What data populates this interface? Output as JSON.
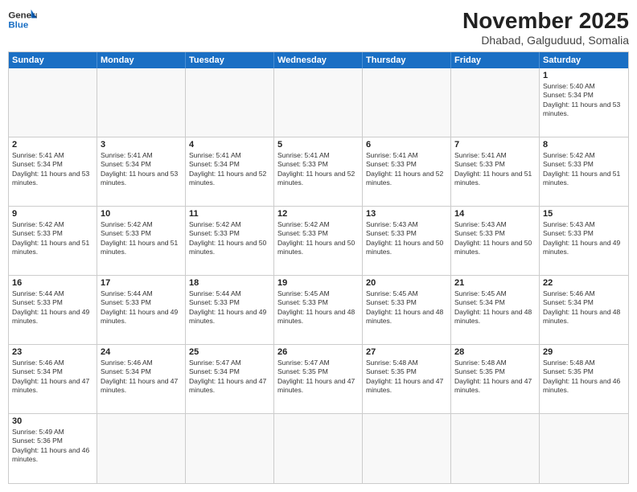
{
  "header": {
    "logo_line1": "General",
    "logo_line2": "Blue",
    "month_title": "November 2025",
    "location": "Dhabad, Galguduud, Somalia"
  },
  "days_of_week": [
    "Sunday",
    "Monday",
    "Tuesday",
    "Wednesday",
    "Thursday",
    "Friday",
    "Saturday"
  ],
  "weeks": [
    [
      {
        "day": "",
        "sunrise": "",
        "sunset": "",
        "daylight": ""
      },
      {
        "day": "",
        "sunrise": "",
        "sunset": "",
        "daylight": ""
      },
      {
        "day": "",
        "sunrise": "",
        "sunset": "",
        "daylight": ""
      },
      {
        "day": "",
        "sunrise": "",
        "sunset": "",
        "daylight": ""
      },
      {
        "day": "",
        "sunrise": "",
        "sunset": "",
        "daylight": ""
      },
      {
        "day": "",
        "sunrise": "",
        "sunset": "",
        "daylight": ""
      },
      {
        "day": "1",
        "sunrise": "Sunrise: 5:40 AM",
        "sunset": "Sunset: 5:34 PM",
        "daylight": "Daylight: 11 hours and 53 minutes."
      }
    ],
    [
      {
        "day": "2",
        "sunrise": "Sunrise: 5:41 AM",
        "sunset": "Sunset: 5:34 PM",
        "daylight": "Daylight: 11 hours and 53 minutes."
      },
      {
        "day": "3",
        "sunrise": "Sunrise: 5:41 AM",
        "sunset": "Sunset: 5:34 PM",
        "daylight": "Daylight: 11 hours and 53 minutes."
      },
      {
        "day": "4",
        "sunrise": "Sunrise: 5:41 AM",
        "sunset": "Sunset: 5:34 PM",
        "daylight": "Daylight: 11 hours and 52 minutes."
      },
      {
        "day": "5",
        "sunrise": "Sunrise: 5:41 AM",
        "sunset": "Sunset: 5:33 PM",
        "daylight": "Daylight: 11 hours and 52 minutes."
      },
      {
        "day": "6",
        "sunrise": "Sunrise: 5:41 AM",
        "sunset": "Sunset: 5:33 PM",
        "daylight": "Daylight: 11 hours and 52 minutes."
      },
      {
        "day": "7",
        "sunrise": "Sunrise: 5:41 AM",
        "sunset": "Sunset: 5:33 PM",
        "daylight": "Daylight: 11 hours and 51 minutes."
      },
      {
        "day": "8",
        "sunrise": "Sunrise: 5:42 AM",
        "sunset": "Sunset: 5:33 PM",
        "daylight": "Daylight: 11 hours and 51 minutes."
      }
    ],
    [
      {
        "day": "9",
        "sunrise": "Sunrise: 5:42 AM",
        "sunset": "Sunset: 5:33 PM",
        "daylight": "Daylight: 11 hours and 51 minutes."
      },
      {
        "day": "10",
        "sunrise": "Sunrise: 5:42 AM",
        "sunset": "Sunset: 5:33 PM",
        "daylight": "Daylight: 11 hours and 51 minutes."
      },
      {
        "day": "11",
        "sunrise": "Sunrise: 5:42 AM",
        "sunset": "Sunset: 5:33 PM",
        "daylight": "Daylight: 11 hours and 50 minutes."
      },
      {
        "day": "12",
        "sunrise": "Sunrise: 5:42 AM",
        "sunset": "Sunset: 5:33 PM",
        "daylight": "Daylight: 11 hours and 50 minutes."
      },
      {
        "day": "13",
        "sunrise": "Sunrise: 5:43 AM",
        "sunset": "Sunset: 5:33 PM",
        "daylight": "Daylight: 11 hours and 50 minutes."
      },
      {
        "day": "14",
        "sunrise": "Sunrise: 5:43 AM",
        "sunset": "Sunset: 5:33 PM",
        "daylight": "Daylight: 11 hours and 50 minutes."
      },
      {
        "day": "15",
        "sunrise": "Sunrise: 5:43 AM",
        "sunset": "Sunset: 5:33 PM",
        "daylight": "Daylight: 11 hours and 49 minutes."
      }
    ],
    [
      {
        "day": "16",
        "sunrise": "Sunrise: 5:44 AM",
        "sunset": "Sunset: 5:33 PM",
        "daylight": "Daylight: 11 hours and 49 minutes."
      },
      {
        "day": "17",
        "sunrise": "Sunrise: 5:44 AM",
        "sunset": "Sunset: 5:33 PM",
        "daylight": "Daylight: 11 hours and 49 minutes."
      },
      {
        "day": "18",
        "sunrise": "Sunrise: 5:44 AM",
        "sunset": "Sunset: 5:33 PM",
        "daylight": "Daylight: 11 hours and 49 minutes."
      },
      {
        "day": "19",
        "sunrise": "Sunrise: 5:45 AM",
        "sunset": "Sunset: 5:33 PM",
        "daylight": "Daylight: 11 hours and 48 minutes."
      },
      {
        "day": "20",
        "sunrise": "Sunrise: 5:45 AM",
        "sunset": "Sunset: 5:33 PM",
        "daylight": "Daylight: 11 hours and 48 minutes."
      },
      {
        "day": "21",
        "sunrise": "Sunrise: 5:45 AM",
        "sunset": "Sunset: 5:34 PM",
        "daylight": "Daylight: 11 hours and 48 minutes."
      },
      {
        "day": "22",
        "sunrise": "Sunrise: 5:46 AM",
        "sunset": "Sunset: 5:34 PM",
        "daylight": "Daylight: 11 hours and 48 minutes."
      }
    ],
    [
      {
        "day": "23",
        "sunrise": "Sunrise: 5:46 AM",
        "sunset": "Sunset: 5:34 PM",
        "daylight": "Daylight: 11 hours and 47 minutes."
      },
      {
        "day": "24",
        "sunrise": "Sunrise: 5:46 AM",
        "sunset": "Sunset: 5:34 PM",
        "daylight": "Daylight: 11 hours and 47 minutes."
      },
      {
        "day": "25",
        "sunrise": "Sunrise: 5:47 AM",
        "sunset": "Sunset: 5:34 PM",
        "daylight": "Daylight: 11 hours and 47 minutes."
      },
      {
        "day": "26",
        "sunrise": "Sunrise: 5:47 AM",
        "sunset": "Sunset: 5:35 PM",
        "daylight": "Daylight: 11 hours and 47 minutes."
      },
      {
        "day": "27",
        "sunrise": "Sunrise: 5:48 AM",
        "sunset": "Sunset: 5:35 PM",
        "daylight": "Daylight: 11 hours and 47 minutes."
      },
      {
        "day": "28",
        "sunrise": "Sunrise: 5:48 AM",
        "sunset": "Sunset: 5:35 PM",
        "daylight": "Daylight: 11 hours and 47 minutes."
      },
      {
        "day": "29",
        "sunrise": "Sunrise: 5:48 AM",
        "sunset": "Sunset: 5:35 PM",
        "daylight": "Daylight: 11 hours and 46 minutes."
      }
    ],
    [
      {
        "day": "30",
        "sunrise": "Sunrise: 5:49 AM",
        "sunset": "Sunset: 5:36 PM",
        "daylight": "Daylight: 11 hours and 46 minutes."
      },
      {
        "day": "",
        "sunrise": "",
        "sunset": "",
        "daylight": ""
      },
      {
        "day": "",
        "sunrise": "",
        "sunset": "",
        "daylight": ""
      },
      {
        "day": "",
        "sunrise": "",
        "sunset": "",
        "daylight": ""
      },
      {
        "day": "",
        "sunrise": "",
        "sunset": "",
        "daylight": ""
      },
      {
        "day": "",
        "sunrise": "",
        "sunset": "",
        "daylight": ""
      },
      {
        "day": "",
        "sunrise": "",
        "sunset": "",
        "daylight": ""
      }
    ]
  ]
}
